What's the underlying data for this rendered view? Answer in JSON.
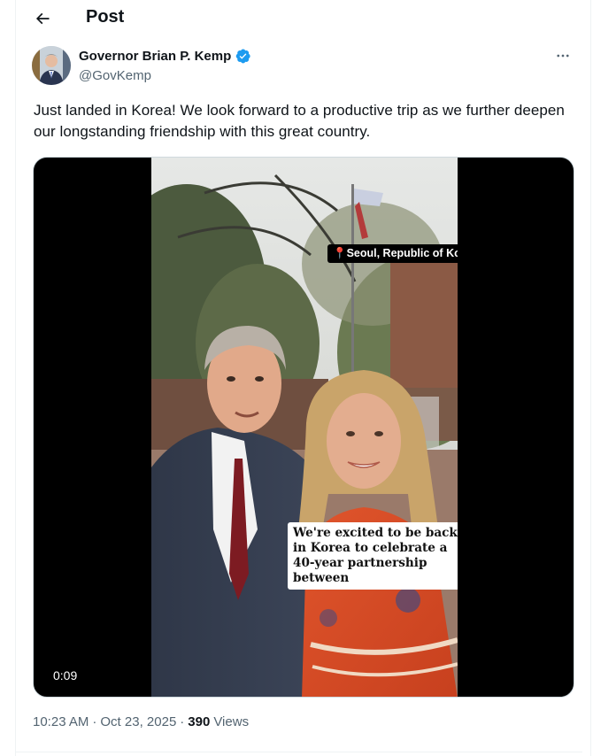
{
  "header": {
    "title": "Post"
  },
  "author": {
    "name": "Governor Brian P. Kemp",
    "handle": "@GovKemp"
  },
  "tweet": {
    "text": "Just landed in Korea! We look forward to a productive trip as we further deepen our longstanding friendship with this great country."
  },
  "video": {
    "duration": "0:09",
    "location_caption": "📍Seoul, Republic of Korea 🇰🇷",
    "quote_caption": "We're excited to be back in Korea to celebrate a 40-year partnership between"
  },
  "meta": {
    "time": "10:23 AM",
    "date": "Oct 23, 2025",
    "separator": "·",
    "views_count": "390",
    "views_label": "Views"
  },
  "colors": {
    "verified": "#1d9bf0",
    "secondary_text": "#536471",
    "primary_text": "#0f1419"
  }
}
